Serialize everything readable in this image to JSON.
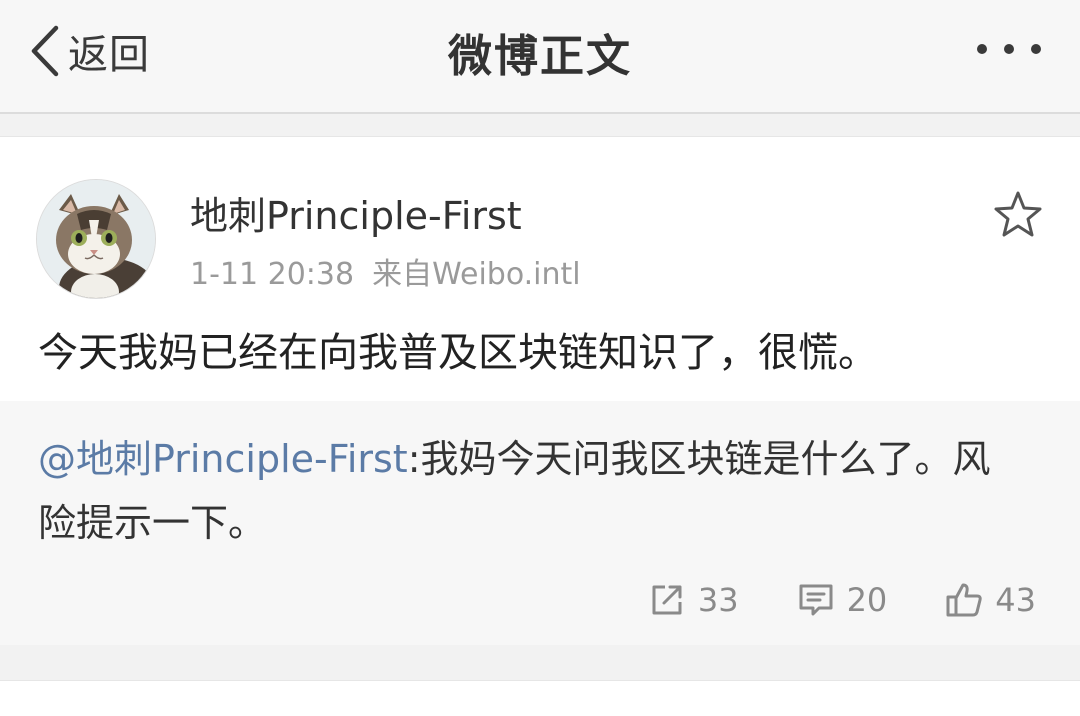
{
  "nav": {
    "back_label": "返回",
    "title": "微博正文"
  },
  "post": {
    "username": "地刺Principle-First",
    "time": "1-11 20:38",
    "source": "来自Weibo.intl",
    "text": "今天我妈已经在向我普及区块链知识了，很慌。",
    "avatar_icon": "cat-avatar",
    "favorite_icon": "star-outline-icon"
  },
  "repost": {
    "mention": "@地刺Principle-First",
    "text": ":我妈今天问我区块链是什么了。风险提示一下。"
  },
  "actions": {
    "share_count": "33",
    "comment_count": "20",
    "like_count": "43"
  },
  "colors": {
    "mention": "#5b7ba6",
    "background": "#f2f2f2",
    "card": "#ffffff"
  }
}
